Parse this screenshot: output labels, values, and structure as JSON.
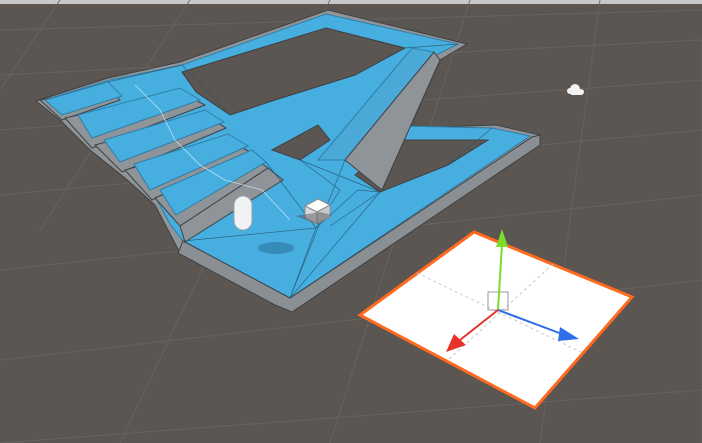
{
  "scene": {
    "background_color": "#5b5652",
    "grid_color": "#6b6561",
    "walkable_color": "#47aee0",
    "wall_color": "#8f9498",
    "plane_color": "#ffffff",
    "selection_outline_color": "#ff6a1f"
  },
  "objects": {
    "navmesh_level": {
      "icon": "navmesh-level"
    },
    "player_capsule": {
      "icon": "capsule"
    },
    "cube": {
      "icon": "cube"
    },
    "plane": {
      "icon": "plane",
      "selected": true
    },
    "light": {
      "icon": "light-bulb-icon"
    }
  },
  "gizmo": {
    "x_axis_color": "#2e6ee6",
    "y_axis_color": "#7bdc2a",
    "z_axis_color": "#e8332a"
  }
}
